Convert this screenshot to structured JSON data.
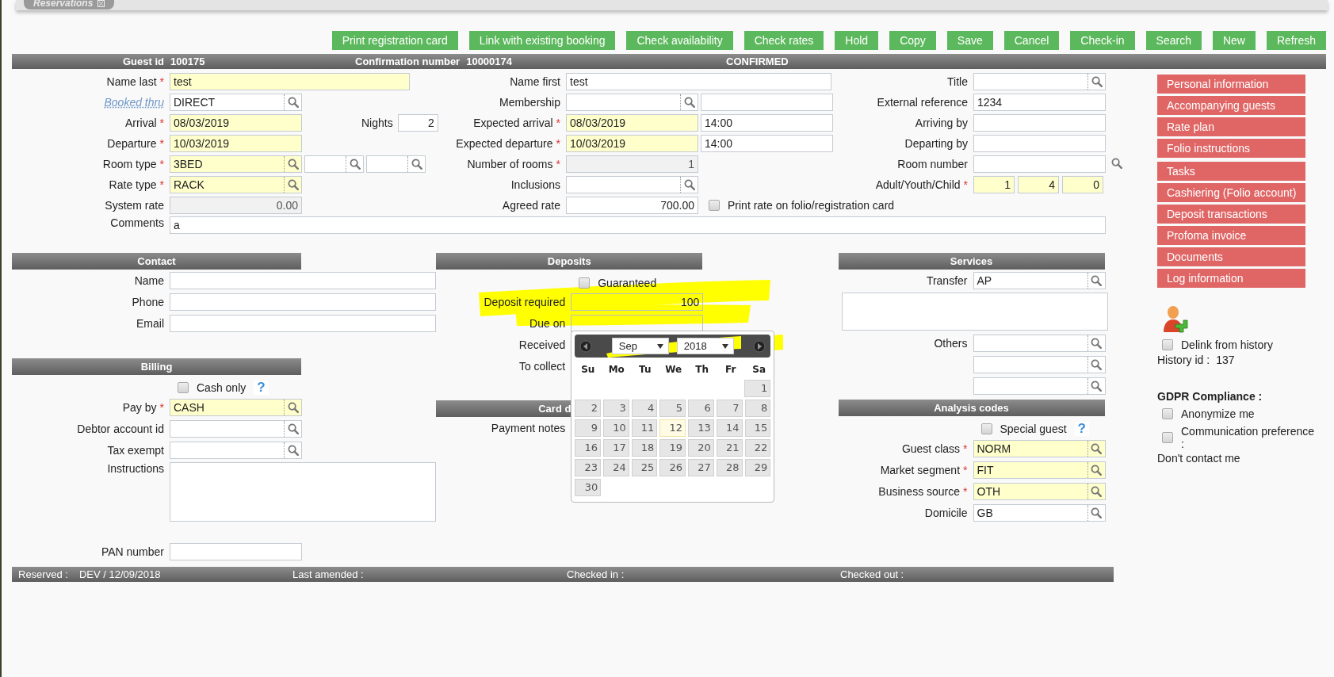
{
  "tab": {
    "label": "Reservations"
  },
  "required_mark": "*",
  "actions": [
    "Print registration card",
    "Link with existing booking",
    "Check availability",
    "Check rates",
    "Hold",
    "Copy",
    "Save",
    "Cancel",
    "Check-in",
    "Search",
    "New",
    "Refresh"
  ],
  "summary": {
    "guest_id_label": "Guest id",
    "guest_id": "100175",
    "confirmation_label": "Confirmation number",
    "confirmation": "10000174",
    "status": "CONFIRMED"
  },
  "main": {
    "columns": [
      {
        "fields": [
          {
            "label": "Name last",
            "required": true,
            "inputs": [
              {
                "kind": "wide",
                "value": "test",
                "mandatory": true
              }
            ]
          },
          {
            "label": "Booked thru",
            "link": true,
            "required": false,
            "inputs": [
              {
                "kind": "lookup",
                "value": "DIRECT",
                "mandatory": false
              }
            ]
          },
          {
            "label": "Arrival",
            "required": true,
            "inputs": [
              {
                "kind": "text",
                "value": "08/03/2019",
                "mandatory": true
              }
            ],
            "extra": {
              "label": "Nights",
              "inputs": [
                {
                  "kind": "short",
                  "value": "2",
                  "mandatory": false
                }
              ]
            }
          },
          {
            "label": "Departure",
            "required": true,
            "inputs": [
              {
                "kind": "text",
                "value": "10/03/2019",
                "mandatory": true
              }
            ]
          },
          {
            "label": "Room type",
            "required": true,
            "inputs": [
              {
                "kind": "lookup",
                "value": "3BED",
                "mandatory": true
              },
              {
                "kind": "lookup-small",
                "mandatory": false
              },
              {
                "kind": "lookup-small",
                "mandatory": false
              }
            ]
          },
          {
            "label": "Rate type",
            "required": true,
            "inputs": [
              {
                "kind": "lookup",
                "value": "RACK",
                "mandatory": true
              }
            ]
          },
          {
            "label": "System rate",
            "required": false,
            "inputs": [
              {
                "kind": "readonly",
                "value": "0.00",
                "mandatory": false
              }
            ]
          }
        ]
      },
      {
        "fields": [
          {
            "label": "Name first",
            "required": false,
            "inputs": [
              {
                "kind": "wide",
                "value": "test",
                "mandatory": false
              }
            ]
          },
          {
            "label": "Membership",
            "required": false,
            "inputs": [
              {
                "kind": "lookup",
                "mandatory": false
              },
              {
                "kind": "text",
                "mandatory": false
              }
            ]
          },
          {
            "label": "Expected arrival",
            "required": true,
            "inputs": [
              {
                "kind": "text",
                "value": "08/03/2019",
                "mandatory": true
              },
              {
                "kind": "text",
                "value": "14:00",
                "mandatory": false
              }
            ]
          },
          {
            "label": "Expected departure",
            "required": true,
            "inputs": [
              {
                "kind": "text",
                "value": "10/03/2019",
                "mandatory": true
              },
              {
                "kind": "text",
                "value": "14:00",
                "mandatory": false
              }
            ]
          },
          {
            "label": "Number of rooms",
            "required": true,
            "inputs": [
              {
                "kind": "readonly",
                "value": "1",
                "mandatory": false
              }
            ]
          },
          {
            "label": "Inclusions",
            "required": false,
            "inputs": [
              {
                "kind": "lookup",
                "mandatory": false
              }
            ]
          },
          {
            "label": "Agreed rate",
            "required": false,
            "inputs": [
              {
                "kind": "number",
                "value": "700.00",
                "mandatory": false
              }
            ],
            "checkbox": {
              "label": "Print rate on folio/registration card",
              "checked": false
            }
          }
        ]
      },
      {
        "fields": [
          {
            "label": "Title",
            "required": false,
            "inputs": [
              {
                "kind": "lookup",
                "mandatory": false
              }
            ]
          },
          {
            "label": "External reference",
            "required": false,
            "inputs": [
              {
                "kind": "text",
                "value": "1234",
                "mandatory": false
              }
            ]
          },
          {
            "label": "Arriving by",
            "required": false,
            "inputs": [
              {
                "kind": "text",
                "mandatory": false
              }
            ]
          },
          {
            "label": "Departing by",
            "required": false,
            "inputs": [
              {
                "kind": "text",
                "mandatory": false
              }
            ]
          },
          {
            "label": "Room number",
            "required": false,
            "inputs": [
              {
                "kind": "text",
                "mandatory": false
              },
              {
                "kind": "search-only"
              }
            ]
          },
          {
            "label": "Adult/Youth/Child",
            "required": true,
            "inputs": [
              {
                "kind": "small",
                "value": "1",
                "mandatory": true
              },
              {
                "kind": "small",
                "value": "4",
                "mandatory": true
              },
              {
                "kind": "small",
                "value": "0",
                "mandatory": true
              }
            ]
          }
        ]
      }
    ],
    "comments": {
      "label": "Comments",
      "value": "a"
    }
  },
  "contact": {
    "title": "Contact",
    "fields": [
      {
        "label": "Name",
        "required": false,
        "inputs": [
          {
            "kind": "long",
            "mandatory": false
          }
        ]
      },
      {
        "label": "Phone",
        "required": false,
        "inputs": [
          {
            "kind": "long",
            "mandatory": false
          }
        ]
      },
      {
        "label": "Email",
        "required": false,
        "inputs": [
          {
            "kind": "long",
            "mandatory": false
          }
        ]
      }
    ]
  },
  "billing": {
    "title": "Billing",
    "cash_only": {
      "label": "Cash only",
      "checked": false,
      "help": "?"
    },
    "fields": [
      {
        "label": "Pay by",
        "required": true,
        "inputs": [
          {
            "kind": "lookup",
            "value": "CASH",
            "mandatory": true
          }
        ]
      },
      {
        "label": "Debtor account id",
        "required": false,
        "inputs": [
          {
            "kind": "lookup",
            "mandatory": false
          }
        ]
      },
      {
        "label": "Tax exempt",
        "required": false,
        "inputs": [
          {
            "kind": "lookup",
            "mandatory": false
          }
        ]
      },
      {
        "label": "Instructions",
        "required": false,
        "inputs": [
          {
            "kind": "area",
            "mandatory": false
          }
        ]
      }
    ],
    "pan": {
      "label": "PAN number",
      "required": false,
      "inputs": [
        {
          "kind": "text",
          "mandatory": false
        }
      ]
    }
  },
  "deposits": {
    "title": "Deposits",
    "guaranteed": {
      "label": "Guaranteed",
      "checked": false
    },
    "fields": [
      {
        "label": "Deposit required",
        "required": false,
        "inputs": [
          {
            "kind": "number",
            "value": "100"
          }
        ]
      },
      {
        "label": "Due on",
        "required": false,
        "inputs": [
          {
            "kind": "text"
          }
        ]
      },
      {
        "label": "Received",
        "required": false
      },
      {
        "label": "To collect",
        "required": false
      }
    ]
  },
  "card": {
    "title": "Card d",
    "fields": [
      {
        "label": "Payment notes",
        "required": false
      }
    ]
  },
  "calendar": {
    "month": "Sep",
    "year": "2018",
    "weekdays": [
      "Su",
      "Mo",
      "Tu",
      "We",
      "Th",
      "Fr",
      "Sa"
    ],
    "weeks": [
      {
        "days": [
          {
            "label": "1",
            "today": false
          }
        ]
      },
      {
        "days": [
          {
            "label": "2",
            "today": false
          },
          {
            "label": "3",
            "today": false
          },
          {
            "label": "4",
            "today": false
          },
          {
            "label": "5",
            "today": false
          },
          {
            "label": "6",
            "today": false
          },
          {
            "label": "7",
            "today": false
          },
          {
            "label": "8",
            "today": false
          }
        ]
      },
      {
        "days": [
          {
            "label": "9",
            "today": false
          },
          {
            "label": "10",
            "today": false
          },
          {
            "label": "11",
            "today": false
          },
          {
            "label": "12",
            "today": true
          },
          {
            "label": "13",
            "today": false
          },
          {
            "label": "14",
            "today": false
          },
          {
            "label": "15",
            "today": false
          }
        ]
      },
      {
        "days": [
          {
            "label": "16",
            "today": false
          },
          {
            "label": "17",
            "today": false
          },
          {
            "label": "18",
            "today": false
          },
          {
            "label": "19",
            "today": false
          },
          {
            "label": "20",
            "today": false
          },
          {
            "label": "21",
            "today": false
          },
          {
            "label": "22",
            "today": false
          }
        ]
      },
      {
        "days": [
          {
            "label": "23",
            "today": false
          },
          {
            "label": "24",
            "today": false
          },
          {
            "label": "25",
            "today": false
          },
          {
            "label": "26",
            "today": false
          },
          {
            "label": "27",
            "today": false
          },
          {
            "label": "28",
            "today": false
          },
          {
            "label": "29",
            "today": false
          }
        ]
      },
      {
        "days": [
          {
            "label": "30",
            "today": false
          }
        ]
      }
    ]
  },
  "services": {
    "title": "Services",
    "fields": [
      {
        "label": "Transfer",
        "required": false,
        "inputs": [
          {
            "kind": "lookup",
            "value": "AP",
            "mandatory": false
          }
        ]
      },
      {
        "inputs": [
          {
            "kind": "area-wide",
            "mandatory": false
          }
        ]
      },
      {
        "label": "Others",
        "required": false,
        "inputs": [
          {
            "kind": "lookup",
            "mandatory": false
          }
        ]
      },
      {
        "inputs": [
          {
            "kind": "lookup",
            "mandatory": false
          }
        ]
      },
      {
        "inputs": [
          {
            "kind": "lookup",
            "mandatory": false
          }
        ]
      }
    ]
  },
  "analysis": {
    "title": "Analysis codes",
    "special_guest": {
      "label": "Special guest",
      "checked": false,
      "help": "?"
    },
    "fields": [
      {
        "label": "Guest class",
        "required": true,
        "inputs": [
          {
            "kind": "lookup",
            "value": "NORM",
            "mandatory": true
          }
        ]
      },
      {
        "label": "Market segment",
        "required": true,
        "inputs": [
          {
            "kind": "lookup",
            "value": "FIT",
            "mandatory": true
          }
        ]
      },
      {
        "label": "Business source",
        "required": true,
        "inputs": [
          {
            "kind": "lookup",
            "value": "OTH",
            "mandatory": true
          }
        ]
      },
      {
        "label": "Domicile",
        "required": false,
        "inputs": [
          {
            "kind": "lookup",
            "value": "GB",
            "mandatory": false
          }
        ]
      }
    ]
  },
  "sidebar": {
    "groups": [
      [
        "Personal information",
        "Accompanying guests",
        "Rate plan",
        "Folio instructions"
      ],
      [
        "Tasks",
        "Cashiering (Folio account)",
        "Deposit transactions",
        "Profoma invoice",
        "Documents",
        "Log information"
      ]
    ]
  },
  "history": {
    "delink": {
      "label": "Delink from history",
      "checked": false
    },
    "id_label": "History id :",
    "id": "137"
  },
  "gdpr": {
    "title": "GDPR Compliance :",
    "options": [
      {
        "label": "Anonymize me",
        "checked": false
      },
      {
        "label": "Communication preference :",
        "checked": false
      }
    ],
    "note": "Don't contact me"
  },
  "footer": [
    {
      "label": "Reserved :",
      "value": "DEV / 12/09/2018"
    },
    {
      "label": "Last amended :"
    },
    {
      "label": "Checked in :"
    },
    {
      "label": "Checked out :"
    }
  ]
}
